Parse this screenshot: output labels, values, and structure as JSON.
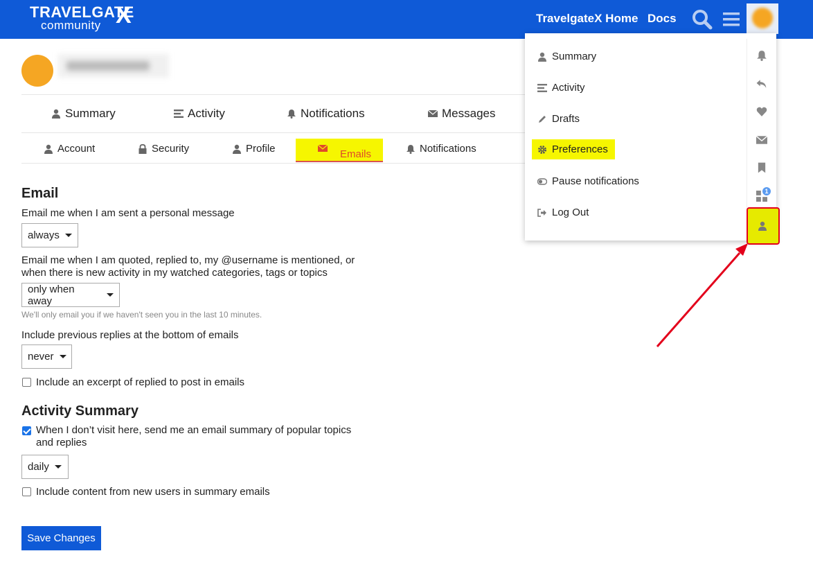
{
  "header": {
    "logo_line1": "TRAVELGATE",
    "logo_line2": "community",
    "logo_x": "X",
    "home_link": "TravelgateX Home",
    "docs_link": "Docs",
    "brand_color": "#0f5ad7"
  },
  "main_nav": {
    "summary": "Summary",
    "activity": "Activity",
    "notifications": "Notifications",
    "messages": "Messages"
  },
  "sub_nav": {
    "account": "Account",
    "security": "Security",
    "profile": "Profile",
    "emails": "Emails",
    "notifications": "Notifications"
  },
  "email_section": {
    "title": "Email",
    "pm_label": "Email me when I am sent a personal message",
    "pm_value": "always",
    "quoted_label_1": "Email me when I am quoted, replied to, my @username is mentioned, or",
    "quoted_label_2": "when there is new activity in my watched categories, tags or topics",
    "quoted_value": "only when away",
    "quoted_hint": "We'll only email you if we haven't seen you in the last 10 minutes.",
    "previous_label": "Include previous replies at the bottom of emails",
    "previous_value": "never",
    "excerpt_label": "Include an excerpt of replied to post in emails"
  },
  "activity_section": {
    "title": "Activity Summary",
    "digest_label_1": "When I don’t visit here, send me an email summary of popular topics",
    "digest_label_2": "and replies",
    "digest_value": "daily",
    "new_users_label": "Include content from new users in summary emails"
  },
  "save_button": "Save Changes",
  "user_menu": {
    "items": {
      "summary": "Summary",
      "activity": "Activity",
      "drafts": "Drafts",
      "preferences": "Preferences",
      "pause": "Pause notifications",
      "logout": "Log Out"
    },
    "badge_count": "1"
  },
  "highlight_color": "#f6f600",
  "annotation_color": "#e3001b"
}
